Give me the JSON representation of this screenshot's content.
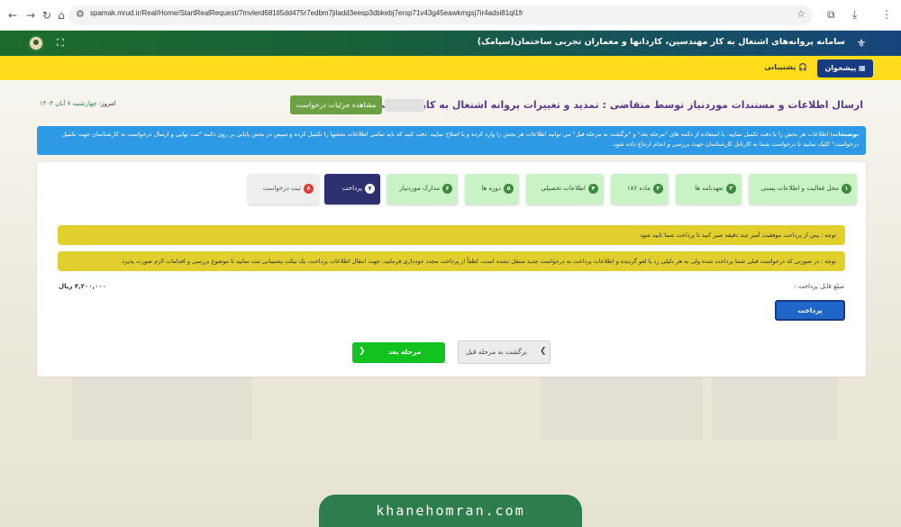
{
  "browser": {
    "url": "spamak.mrud.ir/Real/Home/StartRealRequest/7mvlerd681tl5dd475r7edbm7jiladd3eesp3dbkebj7ersp71v43g45eawkmgsj7ir4adsi81ql1fr"
  },
  "header": {
    "title": "سامانه پروانه‌های اشتغال به کار مهندسین، کاردانها و معماران تجربی ساختمان(سپامک)"
  },
  "menu": {
    "dashboard": "پیشخوان",
    "support": "پشتیبانی"
  },
  "page": {
    "title": "ارسال اطلاعات و مستندات موردنیاز توسط متقاضی : تمدید و تغییرات پروانه اشتغال به کار مهندسی شخص حقیقی",
    "details_button": "مشاهده جزئیات درخواست",
    "date_label": "امروز:",
    "date_value": "چهارشنبه ۷ آبان ۱۴۰۴"
  },
  "info": {
    "heading": "توضیحات:",
    "text": "اطلاعات هر بخش را با دقت تکمیل نمایید. با استفاده از دکمه های \"مرحله بعد\" و \"برگشت به مرحله قبل\" می توانید اطلاعات هر بخش را وارد کرده و یا اصلاح نمایید. دقت کنید که باید تمامی اطلاعات بخشها را تکمیل کرده و سپس در بخش پایانی بر روی دکمه \"ثبت نهایی و ارسال درخواست به کارشناسان جهت تکمیل درخواست\" کلیک نمایید تا درخواست شما به کارتابل کارشناسان جهت بررسی و انجام ارجاع داده شود."
  },
  "steps": [
    {
      "num": "۱",
      "label": "محل فعالیت و اطلاعات پستی",
      "state": "done"
    },
    {
      "num": "۲",
      "label": "تعهدنامه ها",
      "state": "done"
    },
    {
      "num": "۳",
      "label": "ماده ۱۸۶",
      "state": "done"
    },
    {
      "num": "۴",
      "label": "اطلاعات تحصیلی",
      "state": "done"
    },
    {
      "num": "۵",
      "label": "دوره ها",
      "state": "done"
    },
    {
      "num": "۶",
      "label": "مدارک موردنیاز",
      "state": "done"
    },
    {
      "num": "۷",
      "label": "پرداخت",
      "state": "active"
    },
    {
      "num": "۸",
      "label": "ثبت درخواست",
      "state": "pending"
    }
  ],
  "notices": [
    "توجه : پس از پرداخت موفقیت آمیز چند دقیقه صبر کنید تا پرداخت شما تایید شود",
    "توجه : در صورتی که درخواست قبلی شما پرداخت شده ولی به هر دلیلی رد یا لغو گردیده و اطلاعات پرداخت به درخواست جدید منتقل نشده است، لطفاً از پرداخت مجدد خودداری فرمایید. جهت انتقال اطلاعات پرداخت، یک تیکت پشتیبانی ثبت نمایید تا موضوع بررسی و اقدامات لازم صورت پذیرد"
  ],
  "payment": {
    "amount_label": "مبلغ قابل پرداخت :",
    "amount_value": "۴,۲۰۰,۰۰۰ ریال",
    "pay_button": "پرداخت"
  },
  "nav": {
    "next": "مرحله بعد",
    "prev": "برگشت به مرحله قبل"
  },
  "watermark": "khanehomran.com"
}
